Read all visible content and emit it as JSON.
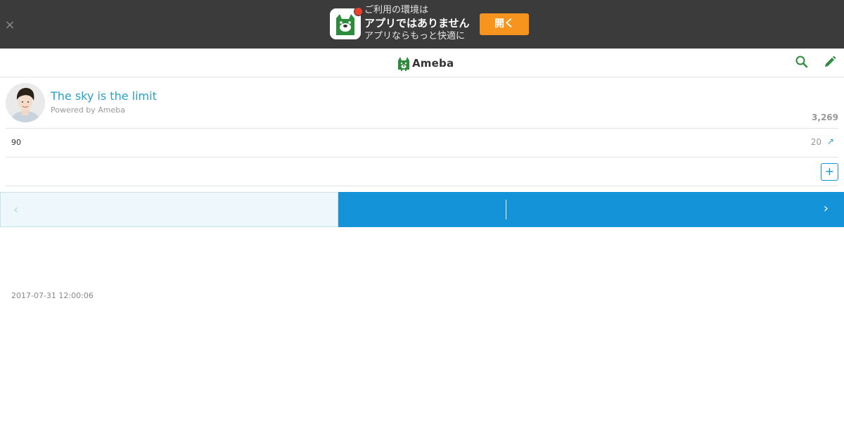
{
  "banner": {
    "close_label": "×",
    "line1": "ご利用の環境は",
    "line2": "アプリではありません",
    "line3": "アプリならもっと快適に",
    "open_label": "開く"
  },
  "header": {
    "logo_text": "Ameba",
    "search_icon": "search-icon",
    "edit_icon": "pencil-icon"
  },
  "profile": {
    "title": "The sky is the limit",
    "powered_by": "Powered by Ameba",
    "readers_count": "3,269"
  },
  "stats": {
    "left_value": "90",
    "right_value": "20",
    "arrow": "↗"
  },
  "follow": {
    "label": "+"
  },
  "pager": {
    "prev_icon": "‹",
    "next_icon": "›"
  },
  "entry": {
    "timestamp": "2017-07-31 12:00:06"
  },
  "colors": {
    "banner_bg": "#3b3b3b",
    "open_button": "#f7941d",
    "brand_green": "#2d8c3c",
    "link_blue": "#2b9fc7",
    "pager_blue": "#1593d8",
    "pager_light": "#edf7fc"
  }
}
